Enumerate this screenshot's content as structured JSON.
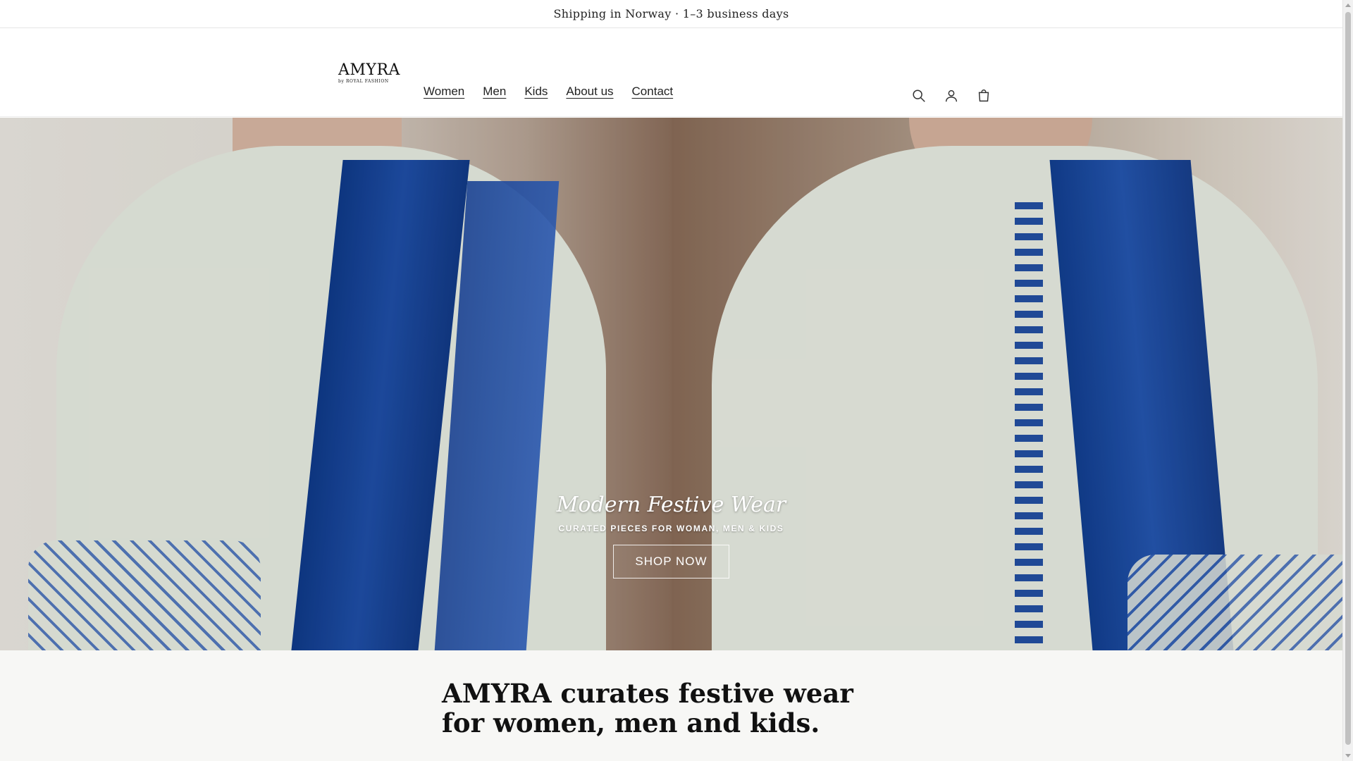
{
  "announcement": {
    "text": "Shipping in Norway · 1–3 business days"
  },
  "header": {
    "logo": {
      "main": "AMYRA",
      "sub": "by ROYAL FASHION"
    },
    "nav": [
      {
        "label": "Women"
      },
      {
        "label": "Men"
      },
      {
        "label": "Kids"
      },
      {
        "label": "About us"
      },
      {
        "label": "Contact"
      }
    ],
    "icons": [
      "search-icon",
      "account-icon",
      "cart-icon"
    ]
  },
  "hero": {
    "title": "Modern Festive Wear",
    "subtitle": "CURATED PIECES FOR WOMAN, MEN & KIDS",
    "button_label": "SHOP NOW",
    "colors": {
      "dupatta_blue": "#1f4fa8",
      "kurta_cream": "#e8ede2"
    }
  },
  "intro": {
    "heading": "AMYRA curates festive wear for women, men and kids."
  }
}
